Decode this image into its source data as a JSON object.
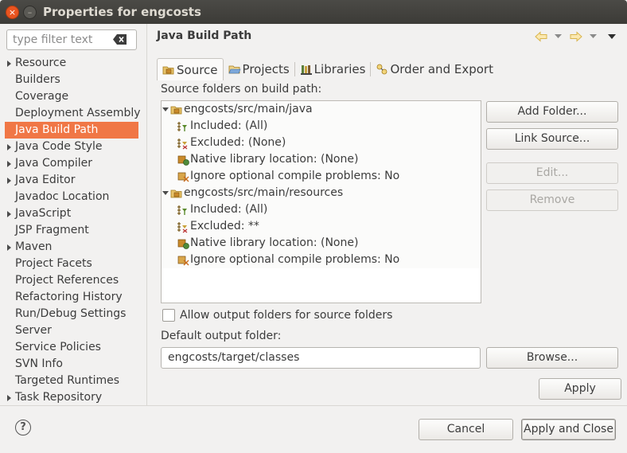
{
  "window": {
    "title": "Properties for engcosts",
    "close_glyph": "×",
    "minimize_glyph": "–"
  },
  "filter": {
    "placeholder": "type filter text"
  },
  "nav": {
    "items": [
      {
        "label": "Resource",
        "expandable": true
      },
      {
        "label": "Builders",
        "expandable": false
      },
      {
        "label": "Coverage",
        "expandable": false
      },
      {
        "label": "Deployment Assembly",
        "expandable": false
      },
      {
        "label": "Java Build Path",
        "expandable": false,
        "selected": true
      },
      {
        "label": "Java Code Style",
        "expandable": true
      },
      {
        "label": "Java Compiler",
        "expandable": true
      },
      {
        "label": "Java Editor",
        "expandable": true
      },
      {
        "label": "Javadoc Location",
        "expandable": false
      },
      {
        "label": "JavaScript",
        "expandable": true
      },
      {
        "label": "JSP Fragment",
        "expandable": false
      },
      {
        "label": "Maven",
        "expandable": true
      },
      {
        "label": "Project Facets",
        "expandable": false
      },
      {
        "label": "Project References",
        "expandable": false
      },
      {
        "label": "Refactoring History",
        "expandable": false
      },
      {
        "label": "Run/Debug Settings",
        "expandable": false
      },
      {
        "label": "Server",
        "expandable": false
      },
      {
        "label": "Service Policies",
        "expandable": false
      },
      {
        "label": "SVN Info",
        "expandable": false
      },
      {
        "label": "Targeted Runtimes",
        "expandable": false
      },
      {
        "label": "Task Repository",
        "expandable": true
      }
    ]
  },
  "page": {
    "title": "Java Build Path"
  },
  "tabs": [
    {
      "label": "Source",
      "icon": "source-folder-icon",
      "active": true
    },
    {
      "label": "Projects",
      "icon": "project-folder-icon",
      "active": false
    },
    {
      "label": "Libraries",
      "icon": "libraries-icon",
      "active": false
    },
    {
      "label": "Order and Export",
      "icon": "order-export-icon",
      "active": false
    }
  ],
  "source": {
    "folders_label": "Source folders on build path:",
    "tree": [
      {
        "label": "engcosts/src/main/java",
        "icon": "package-folder-icon",
        "level": 0
      },
      {
        "label": "Included: (All)",
        "icon": "inclusion-filter-icon",
        "level": 1
      },
      {
        "label": "Excluded: (None)",
        "icon": "exclusion-filter-icon",
        "level": 1
      },
      {
        "label": "Native library location: (None)",
        "icon": "native-library-icon",
        "level": 1
      },
      {
        "label": "Ignore optional compile problems: No",
        "icon": "ignore-problems-icon",
        "level": 1
      },
      {
        "label": "engcosts/src/main/resources",
        "icon": "package-folder-icon",
        "level": 0
      },
      {
        "label": "Included: (All)",
        "icon": "inclusion-filter-icon",
        "level": 1
      },
      {
        "label": "Excluded: **",
        "icon": "exclusion-filter-icon",
        "level": 1
      },
      {
        "label": "Native library location: (None)",
        "icon": "native-library-icon",
        "level": 1
      },
      {
        "label": "Ignore optional compile problems: No",
        "icon": "ignore-problems-icon",
        "level": 1
      }
    ],
    "buttons": {
      "add_folder": "Add Folder...",
      "link_source": "Link Source...",
      "edit": "Edit...",
      "remove": "Remove"
    },
    "allow_output_label": "Allow output folders for source folders",
    "allow_output_checked": false,
    "default_output_label": "Default output folder:",
    "default_output_value": "engcosts/target/classes",
    "browse": "Browse...",
    "apply": "Apply"
  },
  "footer": {
    "help_glyph": "?",
    "cancel": "Cancel",
    "apply_and_close": "Apply and Close"
  },
  "colors": {
    "selection": "#f07746",
    "titlebar": "#3c3b37",
    "close_button": "#e95420",
    "background": "#f2f1f0"
  }
}
